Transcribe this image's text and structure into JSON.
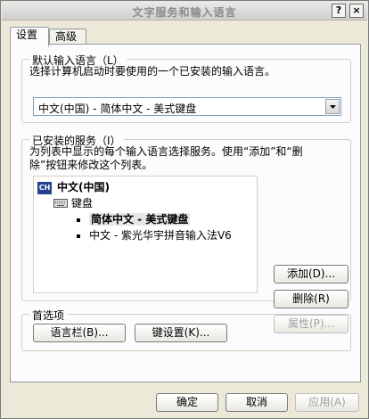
{
  "window": {
    "title": "文字服务和输入语言",
    "help_label": "?",
    "close_label": "×"
  },
  "tabs": [
    {
      "label": "设置",
      "active": true
    },
    {
      "label": "高级",
      "active": false
    }
  ],
  "default_language": {
    "group_label": "默认输入语言（L）",
    "description": "选择计算机启动时要使用的一个已安装的输入语言。",
    "selected_value": "中文(中国) - 简体中文 - 美式键盘"
  },
  "installed_services": {
    "group_label": "已安装的服务（I）",
    "description_line1": "为列表中显示的每个输入语言选择服务。使用“添加”和“删",
    "description_line2": "除”按钮来修改这个列表。",
    "tree": {
      "language": "中文(中国)",
      "language_icon_text": "CH",
      "category": "键盘",
      "items": [
        {
          "label": "简体中文 - 美式键盘",
          "selected": true
        },
        {
          "label": "中文 - 紫光华宇拼音输入法V6",
          "selected": false
        }
      ]
    },
    "buttons": {
      "add": "添加(D)...",
      "remove": "删除(R)",
      "properties": "属性(P)..."
    }
  },
  "preferences": {
    "group_label": "首选项",
    "language_bar_button": "语言栏(B)...",
    "key_settings_button": "键设置(K)..."
  },
  "footer": {
    "ok": "确定",
    "cancel": "取消",
    "apply": "应用(A)"
  }
}
